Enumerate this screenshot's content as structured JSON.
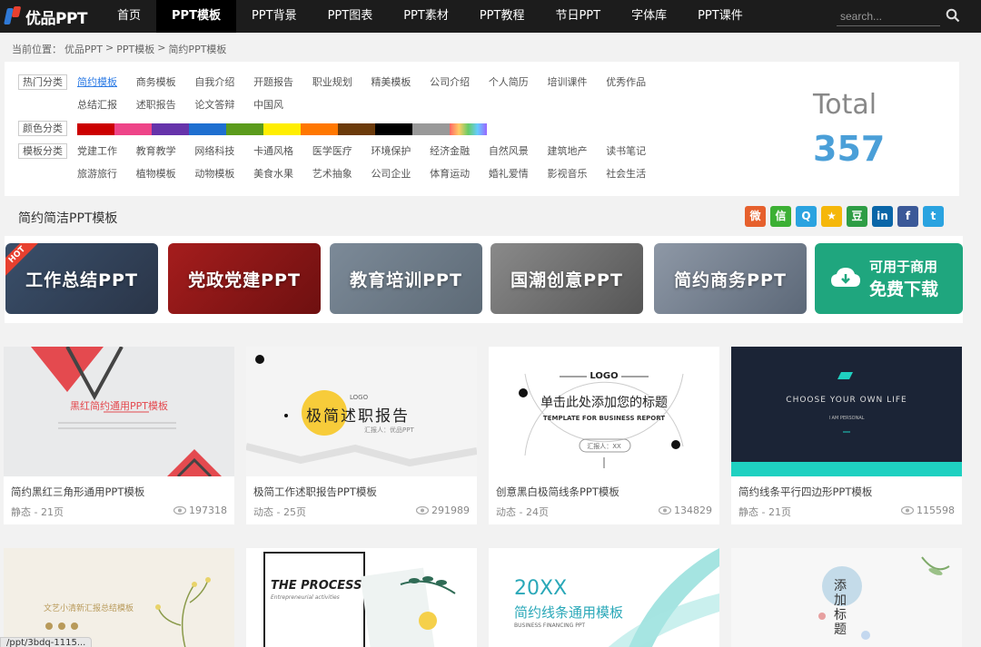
{
  "nav": {
    "logo_text": "优品PPT",
    "items": [
      "首页",
      "PPT模板",
      "PPT背景",
      "PPT图表",
      "PPT素材",
      "PPT教程",
      "节日PPT",
      "字体库",
      "PPT课件"
    ],
    "active_index": 1,
    "search_placeholder": "search..."
  },
  "breadcrumb": {
    "prefix": "当前位置：",
    "items": [
      "优品PPT",
      "PPT模板",
      "简约PPT模板"
    ],
    "sep": ">"
  },
  "filters": {
    "hot_label": "热门分类",
    "hot": [
      "简约模板",
      "商务模板",
      "自我介绍",
      "开题报告",
      "职业规划",
      "精美模板",
      "公司介绍",
      "个人简历",
      "培训课件",
      "优秀作品",
      "总结汇报",
      "述职报告",
      "论文答辩",
      "中国风"
    ],
    "hot_active_index": 0,
    "color_label": "颜色分类",
    "colors": [
      "#cc0000",
      "#ee4488",
      "#6633aa",
      "#1e6fd0",
      "#5b9b1c",
      "#ffee00",
      "#ff7700",
      "#6b3a0a",
      "#000000",
      "#999999",
      "rainbow"
    ],
    "template_label": "模板分类",
    "templates": [
      "党建工作",
      "教育教学",
      "网络科技",
      "卡通风格",
      "医学医疗",
      "环境保护",
      "经济金融",
      "自然风景",
      "建筑地产",
      "读书笔记",
      "旅游旅行",
      "植物模板",
      "动物模板",
      "美食水果",
      "艺术抽象",
      "公司企业",
      "体育运动",
      "婚礼爱情",
      "影视音乐",
      "社会生活"
    ],
    "total_label": "Total",
    "total_value": "357"
  },
  "section_title": "简约简洁PPT模板",
  "share_icons": [
    {
      "name": "weibo-icon",
      "glyph": "微",
      "color": "#e6602d"
    },
    {
      "name": "wechat-icon",
      "glyph": "信",
      "color": "#3cb034"
    },
    {
      "name": "qq-icon",
      "glyph": "Q",
      "color": "#2aa3e0"
    },
    {
      "name": "qzone-icon",
      "glyph": "★",
      "color": "#f5b70a"
    },
    {
      "name": "douban-icon",
      "glyph": "豆",
      "color": "#2e9d45"
    },
    {
      "name": "linkedin-icon",
      "glyph": "in",
      "color": "#0a66a8"
    },
    {
      "name": "facebook-icon",
      "glyph": "f",
      "color": "#3b5998"
    },
    {
      "name": "twitter-icon",
      "glyph": "t",
      "color": "#2aa3e0"
    }
  ],
  "banners": {
    "hot_badge": "HOT",
    "items": [
      "工作总结PPT",
      "党政党建PPT",
      "教育培训PPT",
      "国潮创意PPT",
      "简约商务PPT"
    ],
    "cta_line1": "可用于商用",
    "cta_line2": "免费下载"
  },
  "cards": [
    {
      "title": "简约黑红三角形通用PPT模板",
      "meta": "静态 - 21页",
      "views": "197318",
      "thumb_text": "黑红简约通用PPT模板"
    },
    {
      "title": "极简工作述职报告PPT模板",
      "meta": "动态 - 25页",
      "views": "291989",
      "thumb_text": "极简述职报告",
      "thumb_logo": "LOGO",
      "thumb_sub": "汇报人：优品PPT"
    },
    {
      "title": "创意黑白极简线条PPT模板",
      "meta": "动态 - 24页",
      "views": "134829",
      "thumb_text": "单击此处添加您的标题",
      "thumb_logo": "LOGO",
      "thumb_sub": "TEMPLATE FOR BUSINESS REPORT",
      "thumb_sub2": "汇报人：XX"
    },
    {
      "title": "简约线条平行四边形PPT模板",
      "meta": "静态 - 21页",
      "views": "115598",
      "thumb_text": "CHOOSE YOUR OWN LIFE",
      "thumb_sub": "I AM PERSONAL"
    }
  ],
  "cards_row2": [
    {
      "thumb_text": "文艺小清新汇报总结模板"
    },
    {
      "thumb_text": "THE PROCESS",
      "thumb_sub": "Entrepreneurial activities"
    },
    {
      "thumb_text": "20XX",
      "thumb_sub": "简约线条通用模板",
      "thumb_sub2": "BUSINESS FINANCING PPT"
    },
    {
      "thumb_text": "添加标题"
    }
  ],
  "status_url": "/ppt/3bdq-1115..."
}
